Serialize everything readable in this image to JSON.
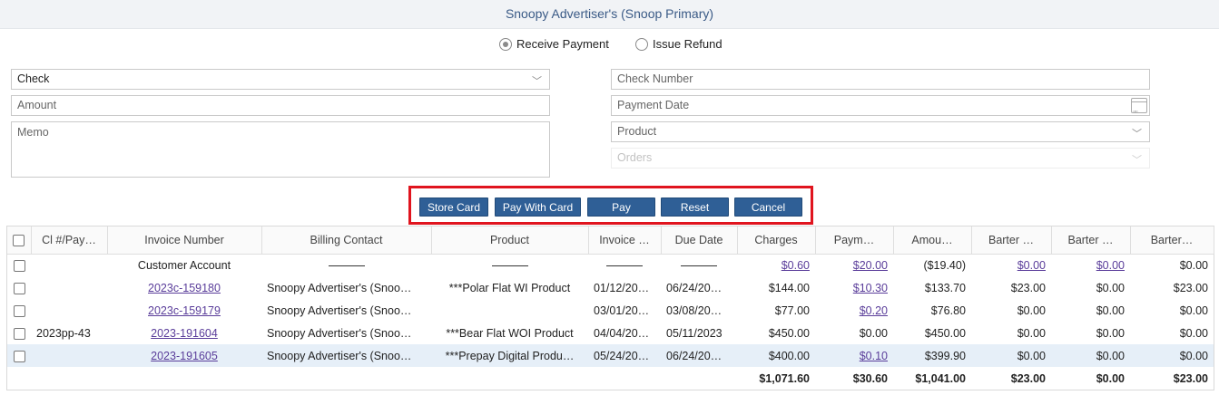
{
  "header": {
    "title": "Snoopy Advertiser's (Snoop Primary)"
  },
  "mode": {
    "receive_label": "Receive Payment",
    "refund_label": "Issue Refund",
    "selected": "receive"
  },
  "form": {
    "payment_method": "Check",
    "amount_placeholder": "Amount",
    "memo_placeholder": "Memo",
    "check_number_placeholder": "Check Number",
    "payment_date_placeholder": "Payment Date",
    "product_placeholder": "Product",
    "orders_placeholder": "Orders"
  },
  "actions": {
    "store_card": "Store Card",
    "pay_with_card": "Pay With Card",
    "pay": "Pay",
    "reset": "Reset",
    "cancel": "Cancel"
  },
  "table": {
    "columns": [
      "Cl #/Pay…",
      "Invoice Number",
      "Billing Contact",
      "Product",
      "Invoice …",
      "Due Date",
      "Charges",
      "Paym…",
      "Amou…",
      "Barter …",
      "Barter …",
      "Barter…"
    ],
    "rows": [
      {
        "cl": "",
        "invoice": "Customer Account",
        "contact": "",
        "product": "",
        "invoice_date": "",
        "due_date": "",
        "charges": "$0.60",
        "payments": "$20.00",
        "amount": "($19.40)",
        "barter1": "$0.00",
        "barter2": "$0.00",
        "barter3": "$0.00"
      },
      {
        "cl": "",
        "invoice": "2023c-159180",
        "contact": "Snoopy Advertiser's (Snoo…",
        "product": "***Polar Flat WI Product",
        "invoice_date": "01/12/20…",
        "due_date": "06/24/20…",
        "charges": "$144.00",
        "payments": "$10.30",
        "amount": "$133.70",
        "barter1": "$23.00",
        "barter2": "$0.00",
        "barter3": "$23.00"
      },
      {
        "cl": "",
        "invoice": "2023c-159179",
        "contact": "Snoopy Advertiser's (Snoo…",
        "product": "",
        "invoice_date": "03/01/20…",
        "due_date": "03/08/20…",
        "charges": "$77.00",
        "payments": "$0.20",
        "amount": "$76.80",
        "barter1": "$0.00",
        "barter2": "$0.00",
        "barter3": "$0.00"
      },
      {
        "cl": "2023pp-43",
        "invoice": "2023-191604",
        "contact": "Snoopy Advertiser's (Snoo…",
        "product": "***Bear Flat WOI Product",
        "invoice_date": "04/04/20…",
        "due_date": "05/11/2023",
        "charges": "$450.00",
        "payments": "$0.00",
        "amount": "$450.00",
        "barter1": "$0.00",
        "barter2": "$0.00",
        "barter3": "$0.00"
      },
      {
        "cl": "",
        "invoice": "2023-191605",
        "contact": "Snoopy Advertiser's (Snoo…",
        "product": "***Prepay Digital Produ…",
        "invoice_date": "05/24/20…",
        "due_date": "06/24/20…",
        "charges": "$400.00",
        "payments": "$0.10",
        "amount": "$399.90",
        "barter1": "$0.00",
        "barter2": "$0.00",
        "barter3": "$0.00"
      }
    ],
    "totals": {
      "charges": "$1,071.60",
      "payments": "$30.60",
      "amount": "$1,041.00",
      "barter1": "$23.00",
      "barter2": "$0.00",
      "barter3": "$23.00"
    }
  },
  "colors": {
    "accent": "#2f5f96",
    "highlight": "#e0141e",
    "link": "#5a3d9a",
    "title": "#3a5a86"
  }
}
